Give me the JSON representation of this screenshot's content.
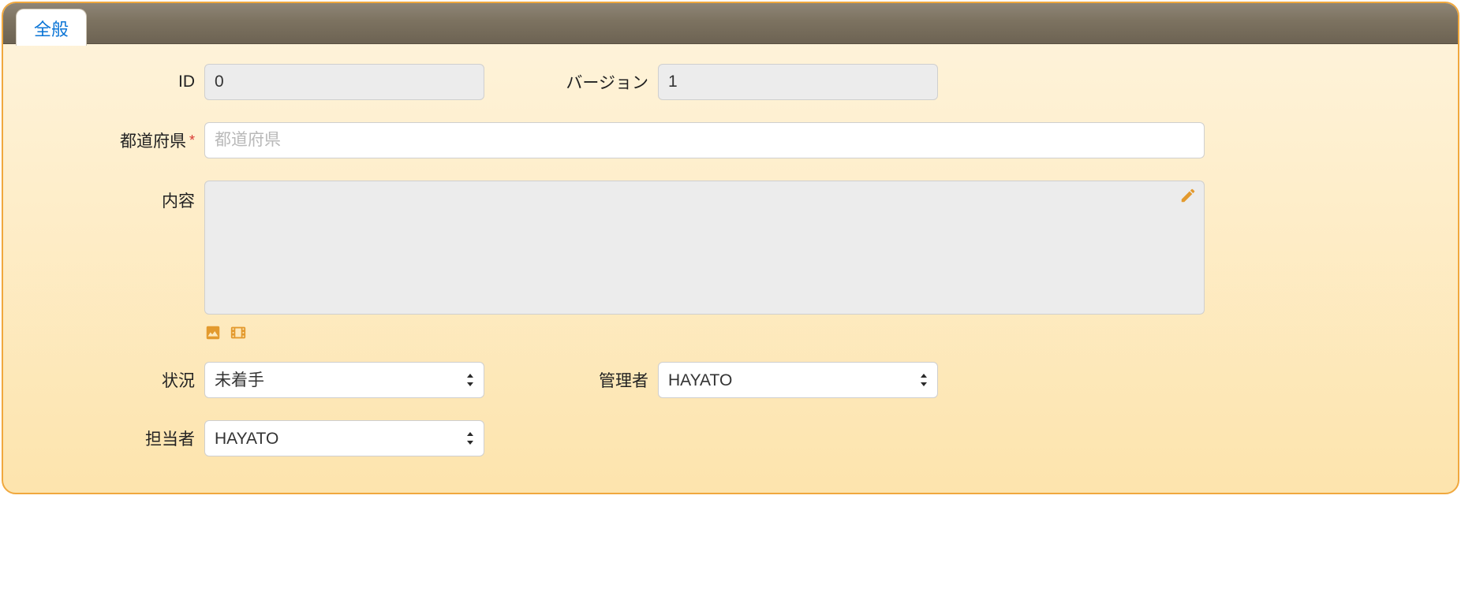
{
  "tab": {
    "label": "全般"
  },
  "fields": {
    "id": {
      "label": "ID",
      "value": "0"
    },
    "version": {
      "label": "バージョン",
      "value": "1"
    },
    "prefecture": {
      "label": "都道府県",
      "placeholder": "都道府県",
      "required_mark": "*"
    },
    "body": {
      "label": "内容",
      "value": ""
    },
    "status": {
      "label": "状況",
      "value": "未着手"
    },
    "manager": {
      "label": "管理者",
      "value": "HAYATO"
    },
    "assignee": {
      "label": "担当者",
      "value": "HAYATO"
    }
  }
}
